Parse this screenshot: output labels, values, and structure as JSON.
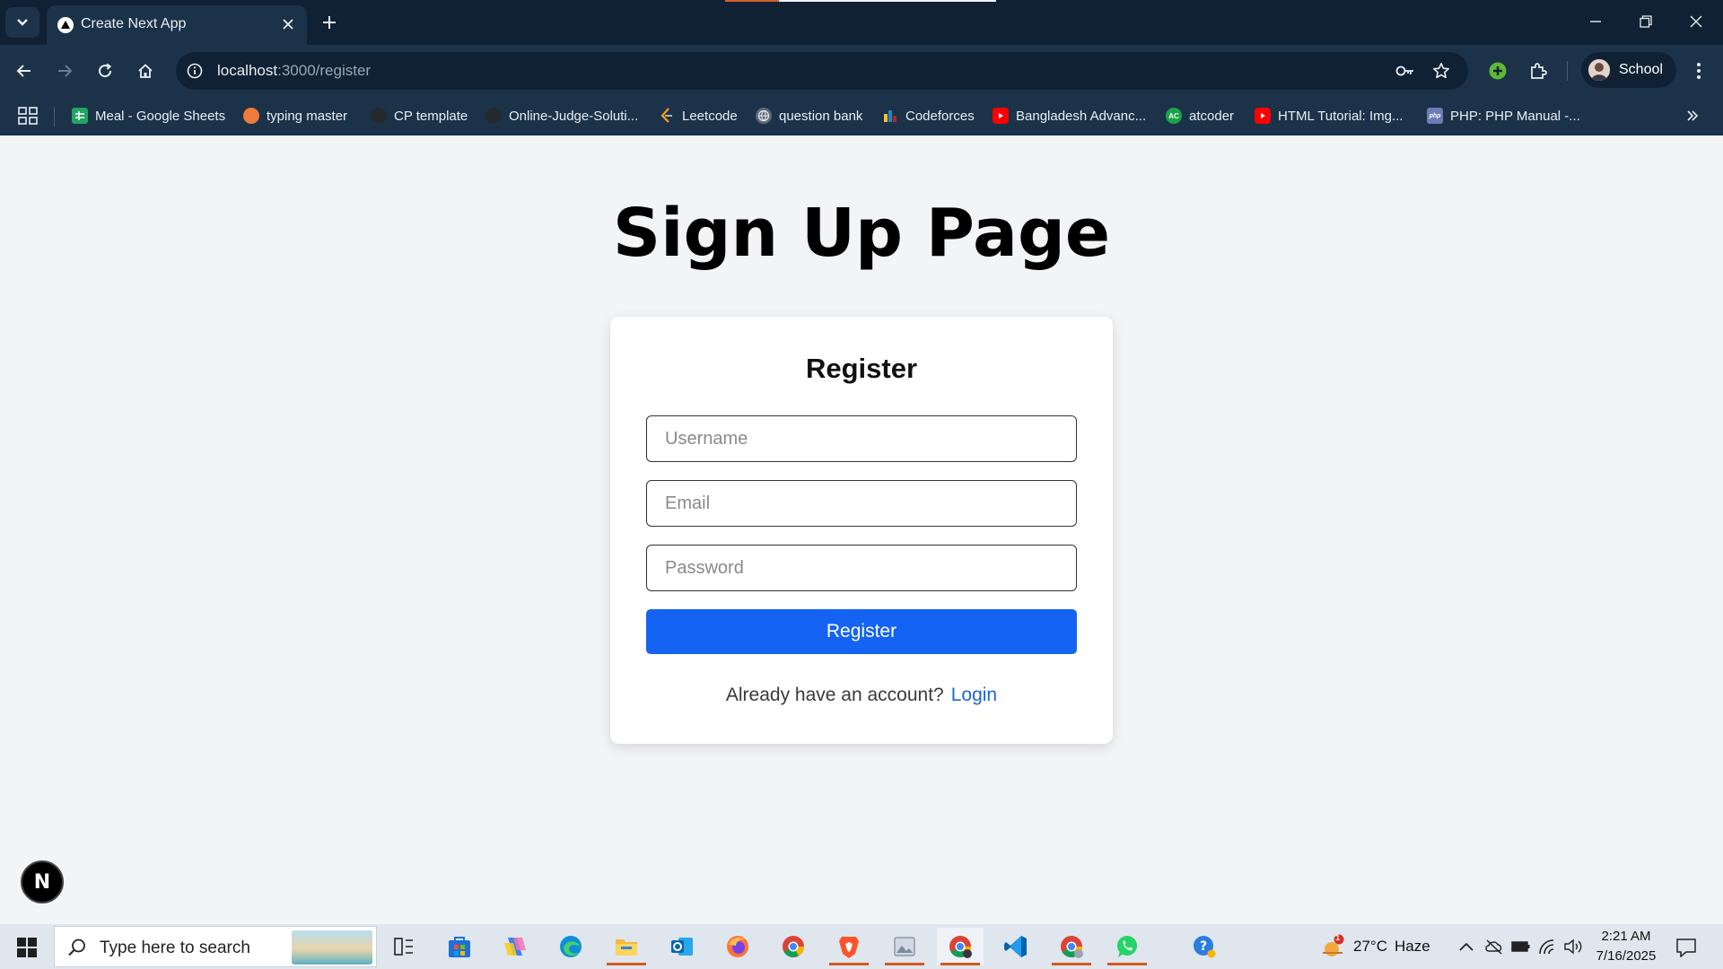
{
  "browser": {
    "tab": {
      "title": "Create Next App"
    },
    "url": {
      "host": "localhost",
      "path": ":3000/register"
    },
    "profile": {
      "name": "School"
    }
  },
  "bookmarks": [
    {
      "label": "Meal - Google Sheets",
      "icon": "google-sheets-icon",
      "color": "#21a464"
    },
    {
      "label": "typing master",
      "icon": "typing-master-icon",
      "color": "#f07a3a"
    },
    {
      "label": "CP template",
      "icon": "github-icon",
      "color": "#24292e"
    },
    {
      "label": "Online-Judge-Soluti...",
      "icon": "github-icon",
      "color": "#24292e"
    },
    {
      "label": "Leetcode",
      "icon": "leetcode-icon",
      "color": "#f89f1b"
    },
    {
      "label": "question bank",
      "icon": "globe-icon",
      "color": "#5f6b77"
    },
    {
      "label": "Codeforces",
      "icon": "codeforces-icon",
      "color": "#1f8acb"
    },
    {
      "label": "Bangladesh Advanc...",
      "icon": "youtube-icon",
      "color": "#ff0000"
    },
    {
      "label": "atcoder",
      "icon": "atcoder-icon",
      "color": "#19a34a"
    },
    {
      "label": "HTML Tutorial: Img...",
      "icon": "youtube-icon",
      "color": "#ff0000"
    },
    {
      "label": "PHP: PHP Manual -...",
      "icon": "php-icon",
      "color": "#6f7bb6"
    }
  ],
  "page": {
    "title": "Sign Up Page",
    "form": {
      "heading": "Register",
      "username_placeholder": "Username",
      "email_placeholder": "Email",
      "password_placeholder": "Password",
      "submit_label": "Register",
      "login_prompt": "Already have an account?",
      "login_link": "Login"
    },
    "dev_badge": "N"
  },
  "taskbar": {
    "search_placeholder": "Type here to search",
    "weather": {
      "temp": "27°C",
      "condition": "Haze",
      "alert_count": "1"
    },
    "clock": {
      "time": "2:21 AM",
      "date": "7/16/2025"
    }
  },
  "colors": {
    "chrome_dark": "#0f2133",
    "chrome_mid": "#1c3248",
    "page_bg": "#f3f4f6",
    "button_primary": "#1463f2",
    "link": "#1a66d9"
  }
}
